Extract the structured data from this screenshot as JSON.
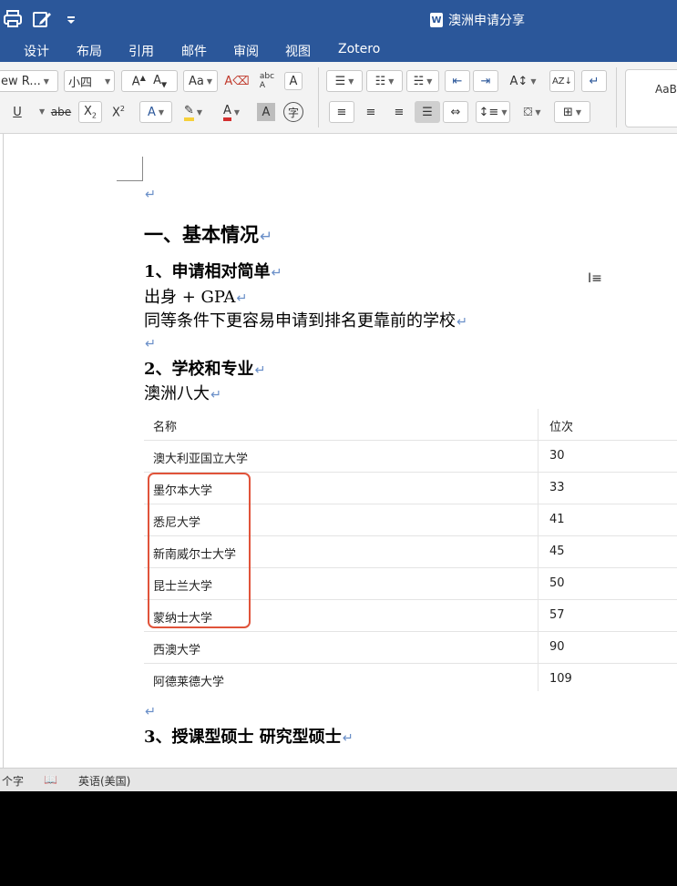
{
  "titlebar": {
    "doc_title": "澳洲申请分享",
    "word_badge": "W"
  },
  "tabs": [
    "设计",
    "布局",
    "引用",
    "邮件",
    "审阅",
    "视图",
    "Zotero"
  ],
  "toolbar": {
    "font_name": "ew R...",
    "font_size": "小四",
    "styles_preview": "AaBl"
  },
  "document": {
    "heading1": "一、基本情况",
    "s1_title": "1、申请相对简单",
    "s1_line1": "出身  + GPA",
    "s1_line2": "同等条件下更容易申请到排名更靠前的学校",
    "s2_title": "2、学校和专业",
    "s2_line1": "澳洲八大",
    "table": {
      "headers": [
        "名称",
        "位次"
      ],
      "rows": [
        [
          "澳大利亚国立大学",
          "30"
        ],
        [
          "墨尔本大学",
          "33"
        ],
        [
          "悉尼大学",
          "41"
        ],
        [
          "新南威尔士大学",
          "45"
        ],
        [
          "昆士兰大学",
          "50"
        ],
        [
          "蒙纳士大学",
          "57"
        ],
        [
          "西澳大学",
          "90"
        ],
        [
          "阿德莱德大学",
          "109"
        ]
      ]
    },
    "s3_title": "3、授课型硕士  研究型硕士",
    "paragraph_mark": "↵"
  },
  "statusbar": {
    "word_count": "个字",
    "language": "英语(美国)"
  },
  "colors": {
    "accent": "#2b579a",
    "highlight_box": "#e0533a"
  }
}
